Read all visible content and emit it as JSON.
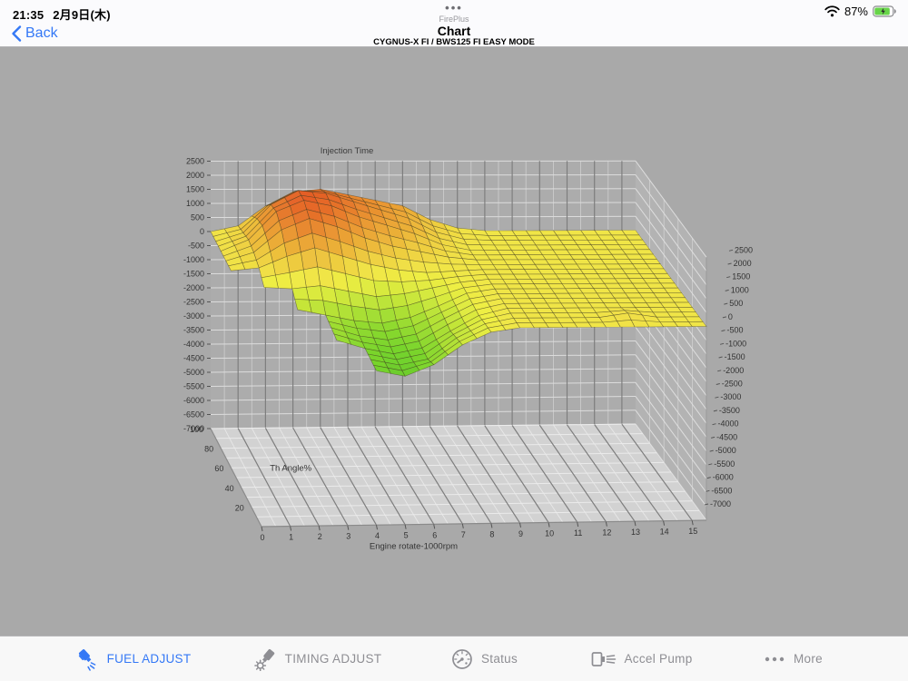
{
  "status_bar": {
    "time": "21:35",
    "date": "2月9日(木)",
    "battery_percent": "87%"
  },
  "nav": {
    "back_label": "Back",
    "app_name": "FirePlus",
    "title": "Chart",
    "subtitle": "CYGNUS-X FI / BWS125 FI EASY MODE",
    "accent_color": "#3478f6"
  },
  "chart_data": {
    "type": "surface3d",
    "title": "Injection Time",
    "xlabel": "Engine rotate-1000rpm",
    "ylabel": "Th Angle%",
    "x_ticks": [
      0,
      1,
      2,
      3,
      4,
      5,
      6,
      7,
      8,
      9,
      10,
      11,
      12,
      13,
      14,
      15
    ],
    "y_ticks": [
      100,
      80,
      60,
      40,
      20
    ],
    "z_ticks": [
      2500,
      2000,
      1500,
      1000,
      500,
      0,
      -500,
      -1000,
      -1500,
      -2000,
      -2500,
      -3000,
      -3500,
      -4000,
      -4500,
      -5000,
      -5500,
      -6000,
      -6500,
      -7000
    ],
    "zlim": [
      -7000,
      2500
    ],
    "x": [
      0,
      1,
      2,
      3,
      4,
      5,
      6,
      7,
      8,
      9,
      10,
      11,
      12,
      13,
      14,
      15
    ],
    "y": [
      0,
      10,
      20,
      30,
      40,
      50,
      60,
      70,
      80,
      90,
      100
    ],
    "surface_rows": [
      {
        "th": 0,
        "values": [
          null,
          null,
          null,
          null,
          -1500,
          -1700,
          -1300,
          -600,
          -150,
          0,
          0,
          0,
          0,
          0,
          0,
          0
        ]
      },
      {
        "th": 10,
        "values": [
          null,
          null,
          null,
          null,
          -1450,
          -1650,
          -1450,
          -700,
          -200,
          0,
          0,
          0,
          0,
          150,
          0,
          0
        ]
      },
      {
        "th": 20,
        "values": [
          null,
          null,
          null,
          -1100,
          -1400,
          -1600,
          -1400,
          -800,
          -250,
          0,
          0,
          0,
          0,
          0,
          0,
          0
        ]
      },
      {
        "th": 30,
        "values": [
          null,
          null,
          null,
          -1000,
          -1300,
          -1450,
          -1250,
          -700,
          -200,
          0,
          0,
          0,
          0,
          0,
          0,
          0
        ]
      },
      {
        "th": 40,
        "values": [
          null,
          null,
          -700,
          -900,
          -1100,
          -1200,
          -1000,
          -600,
          -150,
          0,
          0,
          0,
          0,
          0,
          0,
          0
        ]
      },
      {
        "th": 50,
        "values": [
          null,
          -250,
          -300,
          -200,
          -400,
          -600,
          -500,
          -300,
          -100,
          0,
          0,
          0,
          0,
          0,
          0,
          0
        ]
      },
      {
        "th": 60,
        "values": [
          0,
          100,
          500,
          800,
          500,
          200,
          0,
          -100,
          -50,
          0,
          0,
          0,
          0,
          0,
          0,
          0
        ]
      },
      {
        "th": 70,
        "values": [
          0,
          300,
          1100,
          1500,
          1200,
          800,
          500,
          300,
          100,
          0,
          0,
          0,
          0,
          0,
          0,
          0
        ]
      },
      {
        "th": 80,
        "values": [
          0,
          400,
          1400,
          1800,
          1600,
          1200,
          900,
          600,
          200,
          0,
          0,
          0,
          0,
          0,
          0,
          0
        ]
      },
      {
        "th": 90,
        "values": [
          0,
          300,
          1300,
          1800,
          1700,
          1400,
          1100,
          800,
          300,
          50,
          0,
          0,
          0,
          0,
          0,
          0
        ]
      },
      {
        "th": 100,
        "values": [
          0,
          200,
          900,
          1400,
          1500,
          1300,
          1100,
          900,
          400,
          100,
          0,
          0,
          0,
          0,
          0,
          0
        ]
      }
    ],
    "colors": {
      "low": "green",
      "mid": "yellow",
      "high": "orange-red"
    }
  },
  "tab_bar": {
    "items": [
      {
        "label": "FUEL ADJUST",
        "active": true
      },
      {
        "label": "TIMING ADJUST",
        "active": false
      },
      {
        "label": "Status",
        "active": false
      },
      {
        "label": "Accel Pump",
        "active": false
      },
      {
        "label": "More",
        "active": false
      }
    ]
  }
}
